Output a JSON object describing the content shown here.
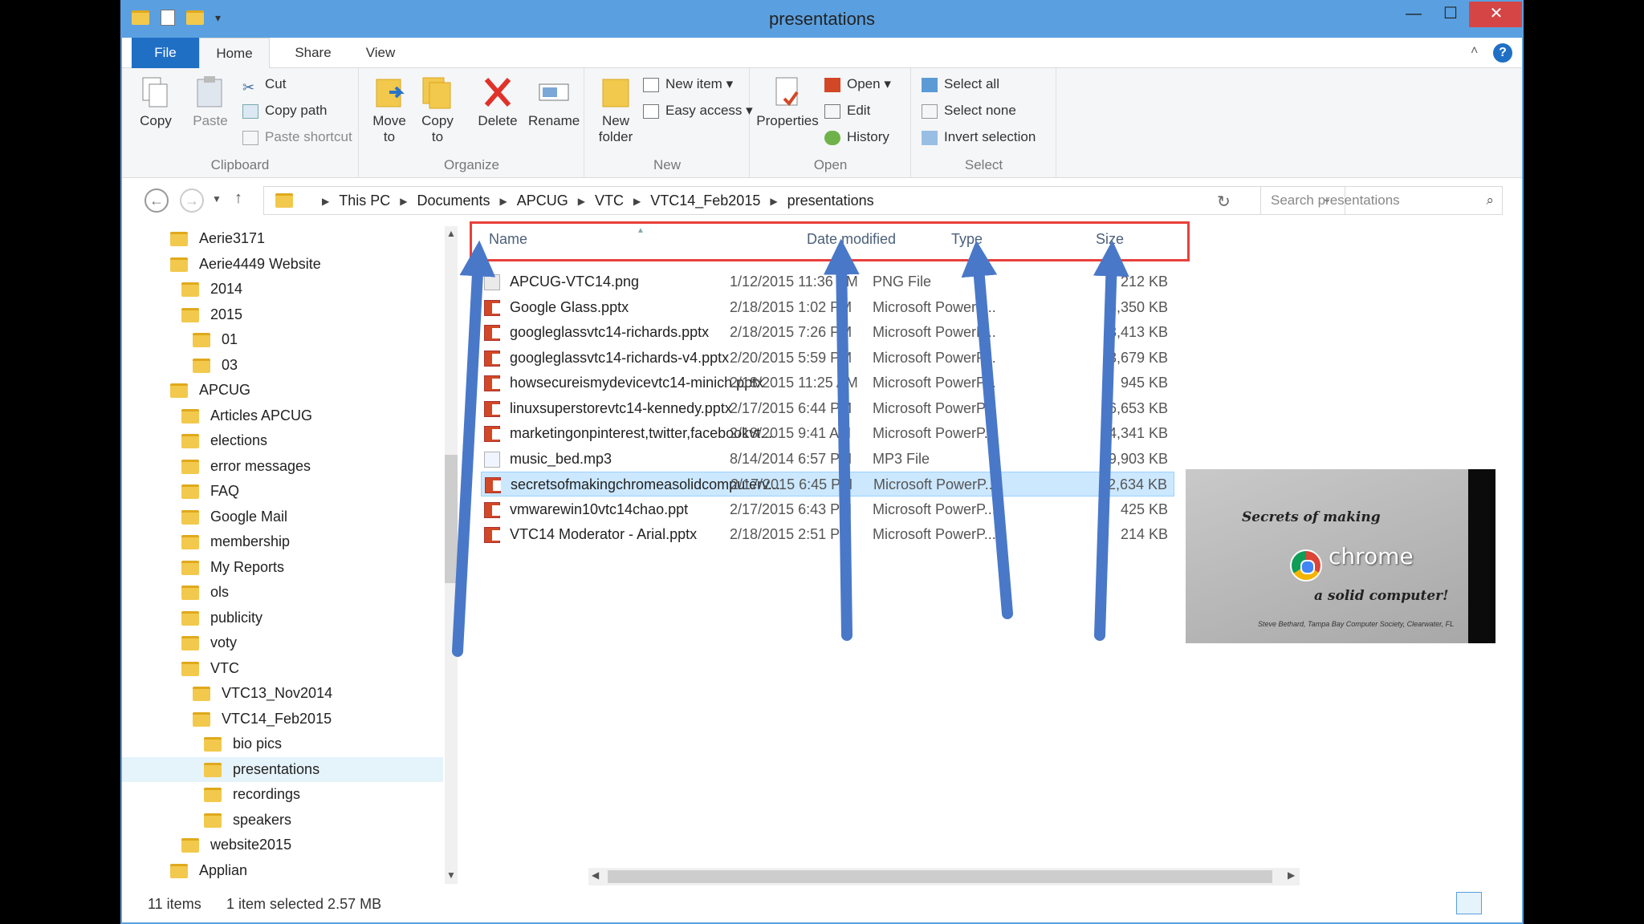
{
  "window": {
    "title": "presentations",
    "min": "—",
    "max": "☐",
    "close": "✕"
  },
  "tabs": {
    "file": "File",
    "home": "Home",
    "share": "Share",
    "view": "View"
  },
  "ribbon": {
    "clipboard": {
      "label": "Clipboard",
      "copy": "Copy",
      "paste": "Paste",
      "cut": "Cut",
      "copy_path": "Copy path",
      "paste_shortcut": "Paste shortcut"
    },
    "organize": {
      "label": "Organize",
      "move_to": "Move to",
      "copy_to": "Copy to",
      "delete": "Delete",
      "rename": "Rename"
    },
    "new": {
      "label": "New",
      "new_folder": "New folder",
      "new_item": "New item",
      "easy_access": "Easy access"
    },
    "open": {
      "label": "Open",
      "properties": "Properties",
      "open": "Open",
      "edit": "Edit",
      "history": "History"
    },
    "select": {
      "label": "Select",
      "select_all": "Select all",
      "select_none": "Select none",
      "invert": "Invert selection"
    }
  },
  "address": {
    "crumbs": [
      "This PC",
      "Documents",
      "APCUG",
      "VTC",
      "VTC14_Feb2015",
      "presentations"
    ],
    "search_placeholder": "Search presentations"
  },
  "nav_tree": [
    {
      "label": "Aerie3171"
    },
    {
      "label": "Aerie4449 Website"
    },
    {
      "label": "2014"
    },
    {
      "label": "2015"
    },
    {
      "label": "01"
    },
    {
      "label": "03"
    },
    {
      "label": "APCUG"
    },
    {
      "label": "Articles APCUG"
    },
    {
      "label": "elections"
    },
    {
      "label": "error messages"
    },
    {
      "label": "FAQ"
    },
    {
      "label": "Google Mail"
    },
    {
      "label": "membership"
    },
    {
      "label": "My Reports"
    },
    {
      "label": "ols"
    },
    {
      "label": "publicity"
    },
    {
      "label": "voty"
    },
    {
      "label": "VTC"
    },
    {
      "label": "VTC13_Nov2014"
    },
    {
      "label": "VTC14_Feb2015"
    },
    {
      "label": "bio pics"
    },
    {
      "label": "presentations"
    },
    {
      "label": "recordings"
    },
    {
      "label": "speakers"
    },
    {
      "label": "website2015"
    },
    {
      "label": "Applian"
    }
  ],
  "columns": {
    "name": "Name",
    "date": "Date modified",
    "type": "Type",
    "size": "Size"
  },
  "files": [
    {
      "name": "APCUG-VTC14.png",
      "date": "1/12/2015 11:36 AM",
      "type": "PNG File",
      "size": "212 KB",
      "icon": "png"
    },
    {
      "name": "Google Glass.pptx",
      "date": "2/18/2015 1:02 PM",
      "type": "Microsoft PowerP...",
      "size": "3,350 KB",
      "icon": "ppt"
    },
    {
      "name": "googleglassvtc14-richards.pptx",
      "date": "2/18/2015 7:26 PM",
      "type": "Microsoft PowerP...",
      "size": "3,413 KB",
      "icon": "ppt"
    },
    {
      "name": "googleglassvtc14-richards-v4.pptx",
      "date": "2/20/2015 5:59 PM",
      "type": "Microsoft PowerP...",
      "size": "3,679 KB",
      "icon": "ppt"
    },
    {
      "name": "howsecureismydevicevtc14-minich.pptx",
      "date": "2/18/2015 11:25 AM",
      "type": "Microsoft PowerP...",
      "size": "945 KB",
      "icon": "ppt"
    },
    {
      "name": "linuxsuperstorevtc14-kennedy.pptx",
      "date": "2/17/2015 6:44 PM",
      "type": "Microsoft PowerP...",
      "size": "6,653 KB",
      "icon": "ppt"
    },
    {
      "name": "marketingonpinterest,twitter,facebookvt...",
      "date": "2/18/2015 9:41 AM",
      "type": "Microsoft PowerP...",
      "size": "4,341 KB",
      "icon": "ppt"
    },
    {
      "name": "music_bed.mp3",
      "date": "8/14/2014 6:57 PM",
      "type": "MP3 File",
      "size": "49,903 KB",
      "icon": "mp3"
    },
    {
      "name": "secretsofmakingchromeasolidcomputerv...",
      "date": "2/17/2015 6:45 PM",
      "type": "Microsoft PowerP...",
      "size": "2,634 KB",
      "icon": "ppt"
    },
    {
      "name": "vmwarewin10vtc14chao.ppt",
      "date": "2/17/2015 6:43 PM",
      "type": "Microsoft PowerP...",
      "size": "425 KB",
      "icon": "ppt"
    },
    {
      "name": "VTC14 Moderator - Arial.pptx",
      "date": "2/18/2015 2:51 PM",
      "type": "Microsoft PowerP...",
      "size": "214 KB",
      "icon": "ppt"
    }
  ],
  "preview": {
    "line1": "Secrets of making",
    "brand": "chrome",
    "line2": "a solid computer!",
    "credit": "Steve Bethard, Tampa Bay Computer Society, Clearwater, FL"
  },
  "status": {
    "count": "11 items",
    "selection": "1 item selected  2.57 MB"
  },
  "colors": {
    "accent": "#1f6fc5",
    "titlebar": "#5aa0e0",
    "highlight": "#e8403a",
    "arrow": "#4a78c8"
  }
}
